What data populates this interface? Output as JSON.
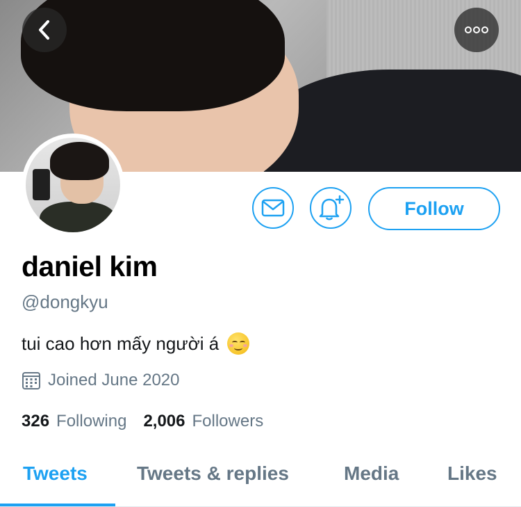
{
  "profile": {
    "display_name": "daniel kim",
    "handle": "@dongkyu",
    "bio": "tui cao hơn mấy người á",
    "bio_emoji": "relieved-face-emoji",
    "joined": "Joined June 2020"
  },
  "stats": {
    "following_count": "326",
    "following_label": "Following",
    "followers_count": "2,006",
    "followers_label": "Followers"
  },
  "actions": {
    "follow_label": "Follow",
    "message_icon": "envelope-icon",
    "notify_icon": "bell-plus-icon",
    "back_icon": "chevron-left-icon",
    "more_icon": "more-dots-icon"
  },
  "tabs": [
    {
      "label": "Tweets",
      "active": true
    },
    {
      "label": "Tweets & replies",
      "active": false
    },
    {
      "label": "Media",
      "active": false
    },
    {
      "label": "Likes",
      "active": false
    }
  ],
  "colors": {
    "accent": "#1da1f2",
    "secondary_text": "#657786",
    "primary_text": "#14171a"
  }
}
